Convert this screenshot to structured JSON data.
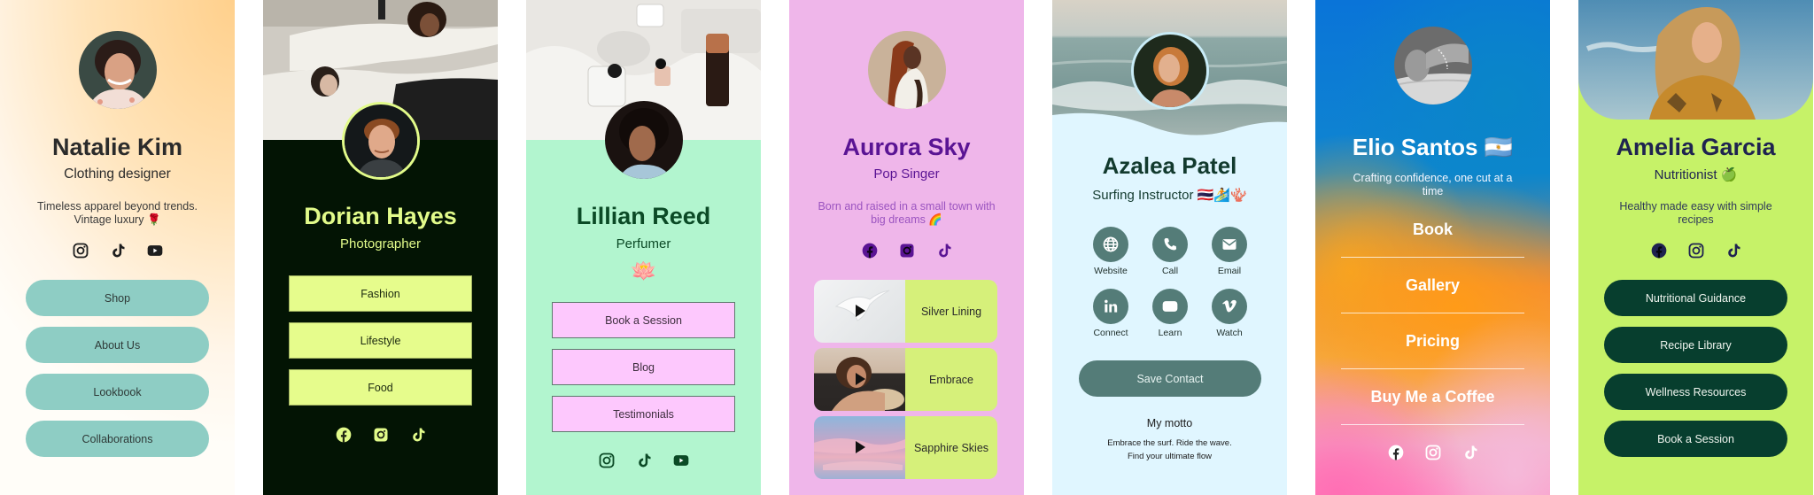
{
  "cards": [
    {
      "name": "Natalie Kim",
      "role": "Clothing designer",
      "bio": "Timeless apparel beyond trends. Vintage luxury 🌹",
      "socials": [
        "instagram-icon",
        "tiktok-icon",
        "youtube-icon"
      ],
      "buttons": [
        "Shop",
        "About Us",
        "Lookbook",
        "Collaborations"
      ],
      "colors": {
        "button_bg": "#8ecdc4",
        "text": "#2b2b2b",
        "bg_top": "#ffd08c"
      }
    },
    {
      "name": "Dorian Hayes",
      "role": "Photographer",
      "socials": [
        "facebook-icon",
        "instagram-icon",
        "tiktok-icon"
      ],
      "buttons": [
        "Fashion",
        "Lifestyle",
        "Food"
      ],
      "colors": {
        "bg": "#031404",
        "accent": "#e2fb8a"
      }
    },
    {
      "name": "Lillian Reed",
      "role": "Perfumer",
      "emoji": "🪷",
      "socials": [
        "instagram-icon",
        "tiktok-icon",
        "youtube-icon"
      ],
      "buttons": [
        "Book a Session",
        "Blog",
        "Testimonials"
      ],
      "colors": {
        "bg": "#b2f5cf",
        "button_bg": "#fdc8fd",
        "text": "#0b4a26"
      }
    },
    {
      "name": "Aurora Sky",
      "role": "Pop Singer",
      "bio": "Born and raised in a small town with big dreams 🌈",
      "socials": [
        "facebook-icon",
        "instagram-icon",
        "tiktok-icon"
      ],
      "tracks": [
        "Silver Lining",
        "Embrace",
        "Sapphire Skies"
      ],
      "colors": {
        "bg": "#efb6ea",
        "text": "#5a1494",
        "track_bg": "#d6f07a"
      }
    },
    {
      "name": "Azalea Patel",
      "role": "Surfing Instructor 🇹🇭🏄🪸",
      "actions": [
        {
          "label": "Website",
          "icon": "globe-icon"
        },
        {
          "label": "Call",
          "icon": "phone-icon"
        },
        {
          "label": "Email",
          "icon": "email-icon"
        },
        {
          "label": "Connect",
          "icon": "linkedin-icon"
        },
        {
          "label": "Learn",
          "icon": "youtube-icon"
        },
        {
          "label": "Watch",
          "icon": "vimeo-icon"
        }
      ],
      "save_label": "Save Contact",
      "motto_title": "My motto",
      "motto_line1": "Embrace the surf. Ride the wave.",
      "motto_line2": "Find your ultimate flow",
      "colors": {
        "bg": "#e0f6ff",
        "button_bg": "#547c78",
        "text": "#123a2e"
      }
    },
    {
      "name": "Elio Santos 🇦🇷",
      "bio": "Crafting confidence, one cut at a time",
      "links": [
        "Book",
        "Gallery",
        "Pricing",
        "Buy Me a Coffee"
      ],
      "socials": [
        "facebook-icon",
        "instagram-icon",
        "tiktok-icon"
      ],
      "colors": {
        "top": "#0a74d8",
        "middle": "#ff9b18",
        "bottom": "#ff88c0"
      }
    },
    {
      "name": "Amelia Garcia",
      "role": "Nutritionist 🍏",
      "bio": "Healthy made easy with simple recipes",
      "socials": [
        "facebook-icon",
        "instagram-icon",
        "tiktok-icon"
      ],
      "buttons": [
        "Nutritional Guidance",
        "Recipe Library",
        "Wellness Resources",
        "Book a Session"
      ],
      "colors": {
        "bg": "#c6f268",
        "button_bg": "#073e2e",
        "text": "#1f2350"
      }
    }
  ]
}
